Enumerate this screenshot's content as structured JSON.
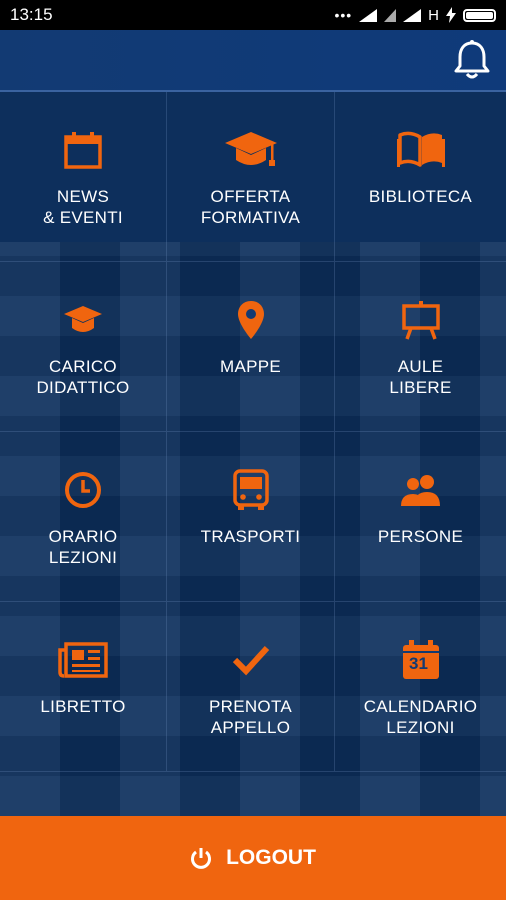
{
  "status_bar": {
    "time": "13:15",
    "dots": "•••",
    "network_h": "H"
  },
  "header": {
    "bell_icon": "bell-icon"
  },
  "colors": {
    "accent": "#f0650f",
    "background": "#0d2f5c",
    "text": "#ffffff"
  },
  "menu": [
    {
      "label": "NEWS\n& EVENTI",
      "icon": "calendar-icon"
    },
    {
      "label": "OFFERTA\nFORMATIVA",
      "icon": "graduation-cap-icon"
    },
    {
      "label": "BIBLIOTECA",
      "icon": "book-icon"
    },
    {
      "label": "CARICO\nDIDATTICO",
      "icon": "mortarboard-icon"
    },
    {
      "label": "MAPPE",
      "icon": "map-pin-icon"
    },
    {
      "label": "AULE\nLIBERE",
      "icon": "easel-icon"
    },
    {
      "label": "ORARIO\nLEZIONI",
      "icon": "clock-icon"
    },
    {
      "label": "TRASPORTI",
      "icon": "bus-icon"
    },
    {
      "label": "PERSONE",
      "icon": "people-icon"
    },
    {
      "label": "LIBRETTO",
      "icon": "newspaper-icon"
    },
    {
      "label": "PRENOTA\nAPPELLO",
      "icon": "check-icon"
    },
    {
      "label": "CALENDARIO\nLEZIONI",
      "icon": "calendar-31-icon"
    }
  ],
  "calendar_day": "31",
  "logout": {
    "label": "LOGOUT",
    "icon": "power-icon"
  }
}
